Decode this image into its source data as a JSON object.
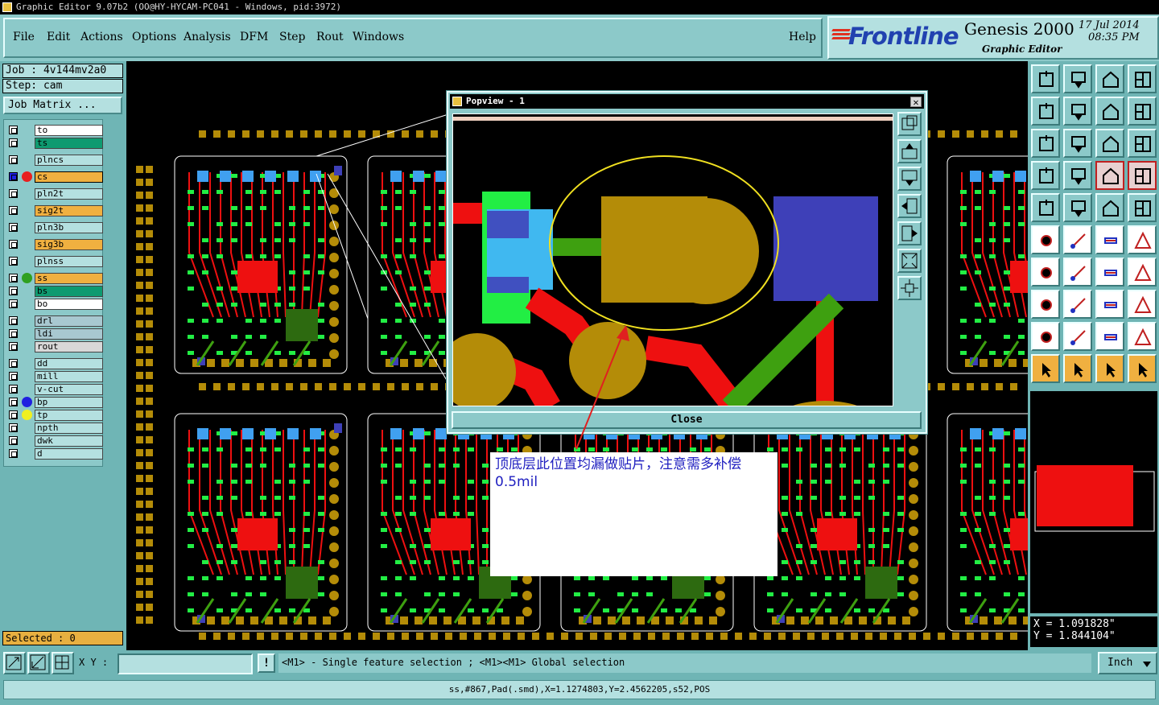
{
  "window": {
    "title": "Graphic Editor 9.07b2 (OO@HY-HYCAM-PC041 - Windows, pid:3972)"
  },
  "menu": [
    "File",
    "Edit",
    "Actions",
    "Options",
    "Analysis",
    "DFM",
    "Step",
    "Rout",
    "Windows"
  ],
  "help_label": "Help",
  "logo": {
    "brand": "Frontline",
    "product": "Genesis 2000",
    "subtitle": "Graphic Editor",
    "date": "17 Jul 2014",
    "time": "08:35 PM"
  },
  "job": {
    "job_label": "Job : 4v144mv2a0",
    "step_label": "Step: cam",
    "matrix_button": "Job Matrix ..."
  },
  "layers": [
    {
      "name": "to",
      "color": "#ffffff"
    },
    {
      "name": "ts",
      "color": "#0e9a70"
    },
    {
      "name": "plncs",
      "color": "#b4e0e0"
    },
    {
      "name": "cs",
      "color": "#f0b040",
      "active": true,
      "dot": "#e82020"
    },
    {
      "name": "pln2t",
      "color": "#b4e0e0"
    },
    {
      "name": "sig2t",
      "color": "#f0b040"
    },
    {
      "name": "pln3b",
      "color": "#b4e0e0"
    },
    {
      "name": "sig3b",
      "color": "#f0b040"
    },
    {
      "name": "plnss",
      "color": "#b4e0e0"
    },
    {
      "name": "ss",
      "color": "#f0b040",
      "dot": "#30a020"
    },
    {
      "name": "bs",
      "color": "#0e9a70"
    },
    {
      "name": "bo",
      "color": "#ffffff"
    },
    {
      "name": "drl",
      "color": "#a8c8d0"
    },
    {
      "name": "ldi",
      "color": "#a8c8d0"
    },
    {
      "name": "rout",
      "color": "#d8d8d8"
    },
    {
      "name": "dd",
      "color": "#b4e0e0"
    },
    {
      "name": "mill",
      "color": "#b4e0e0"
    },
    {
      "name": "v-cut",
      "color": "#b4e0e0"
    },
    {
      "name": "bp",
      "color": "#b4e0e0",
      "dot": "#2020e0"
    },
    {
      "name": "tp",
      "color": "#b4e0e0",
      "dot": "#f0f020"
    },
    {
      "name": "npth",
      "color": "#b4e0e0"
    },
    {
      "name": "dwk",
      "color": "#b4e0e0"
    },
    {
      "name": "d",
      "color": "#b4e0e0"
    }
  ],
  "selected_label": "Selected : 0",
  "popview": {
    "title": "Popview - 1",
    "close_label": "Close"
  },
  "note_text": "顶底层此位置均漏做贴片，注意需多补偿0.5mil",
  "coords": {
    "x": "X = 1.091828\"",
    "y": "Y = 1.844104\""
  },
  "cmd": {
    "xy_label": "X Y :",
    "xy_value": "",
    "message": "<M1> - Single feature selection ; <M1><M1> Global selection",
    "unit": "Inch"
  },
  "status_text": "ss,#867,Pad(.smd),X=1.1274803,Y=2.4562205,s52,POS"
}
